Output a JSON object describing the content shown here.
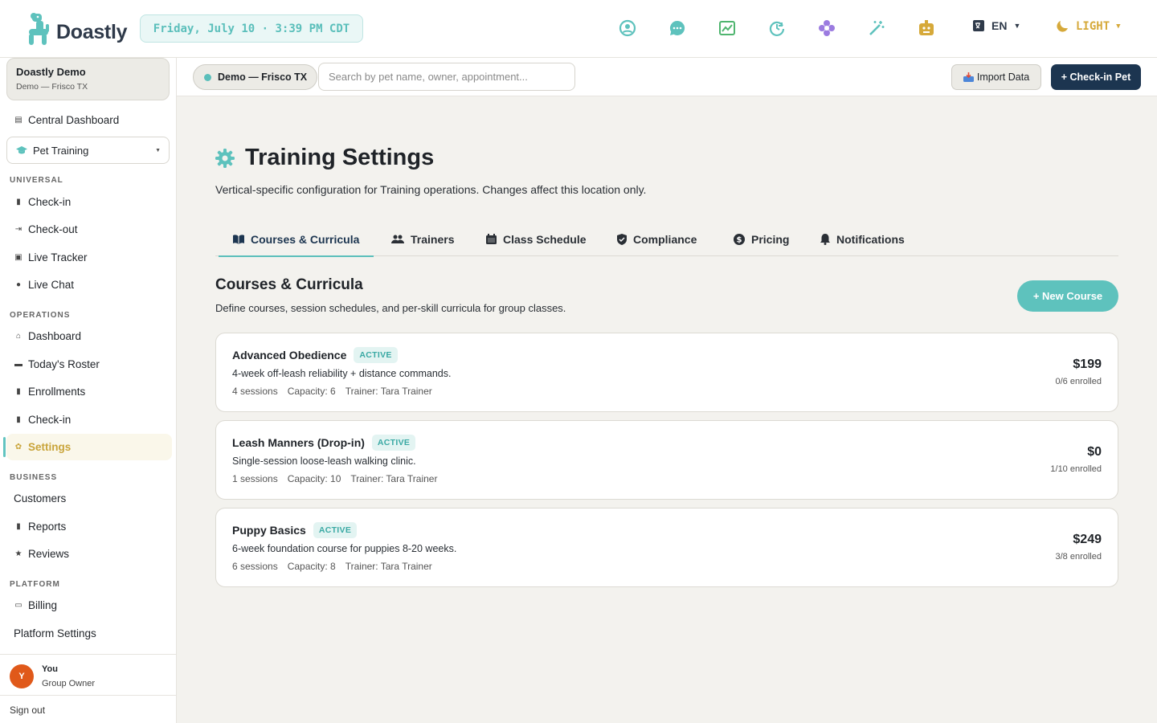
{
  "app": {
    "brand": "Doastly",
    "datetime": "Friday, July 10 · 3:39 PM CDT",
    "language": "EN",
    "theme": "LIGHT",
    "top_icons": [
      "account-icon",
      "chat-icon",
      "chart-icon",
      "clock-icon",
      "flower-icon",
      "magic-wand-icon",
      "robot-icon"
    ]
  },
  "org": {
    "name": "Doastly Demo",
    "sub": "Demo — Frisco TX"
  },
  "sidebar": {
    "dashboard": "Central Dashboard",
    "vertical": "Pet Training",
    "sections": {
      "universal": "UNIVERSAL",
      "operations": "OPERATIONS",
      "business": "BUSINESS",
      "platform": "PLATFORM"
    },
    "universal": [
      "Check-in",
      "Check-out",
      "Live Tracker",
      "Live Chat"
    ],
    "operations": [
      "Dashboard",
      "Today's Roster",
      "Enrollments",
      "Check-in",
      "Settings"
    ],
    "business": [
      "Customers",
      "Reports",
      "Reviews"
    ],
    "platform": [
      "Billing",
      "Platform Settings"
    ],
    "active_item": "Settings"
  },
  "user": {
    "initial": "Y",
    "name": "You",
    "role": "Group Owner",
    "signout": "Sign out"
  },
  "toolbar": {
    "location": "Demo — Frisco TX",
    "search_placeholder": "Search by pet name, owner, appointment...",
    "import_label": "Import Data",
    "checkin_label": "+ Check-in Pet"
  },
  "page": {
    "title": "Training Settings",
    "description": "Vertical-specific configuration for Training operations. Changes affect this location only.",
    "tabs": [
      "Courses & Curricula",
      "Trainers",
      "Class Schedule",
      "Compliance",
      "Pricing",
      "Notifications"
    ],
    "active_tab": "Courses & Curricula"
  },
  "courses_section": {
    "title": "Courses & Curricula",
    "description": "Define courses, session schedules, and per-skill curricula for group classes.",
    "new_button": "+ New Course",
    "items": [
      {
        "name": "Advanced Obedience",
        "status": "ACTIVE",
        "description": "4-week off-leash reliability + distance commands.",
        "sessions": "4 sessions",
        "capacity": "Capacity: 6",
        "trainer": "Trainer: Tara Trainer",
        "price": "$199",
        "enrolled": "0/6 enrolled"
      },
      {
        "name": "Leash Manners (Drop-in)",
        "status": "ACTIVE",
        "description": "Single-session loose-leash walking clinic.",
        "sessions": "1 sessions",
        "capacity": "Capacity: 10",
        "trainer": "Trainer: Tara Trainer",
        "price": "$0",
        "enrolled": "1/10 enrolled"
      },
      {
        "name": "Puppy Basics",
        "status": "ACTIVE",
        "description": "6-week foundation course for puppies 8-20 weeks.",
        "sessions": "6 sessions",
        "capacity": "Capacity: 8",
        "trainer": "Trainer: Tara Trainer",
        "price": "$249",
        "enrolled": "3/8 enrolled"
      }
    ]
  },
  "colors": {
    "teal": "#5bbfbb",
    "navy": "#1c3550",
    "gold": "#d6a93a",
    "avatar": "#e0591a"
  }
}
